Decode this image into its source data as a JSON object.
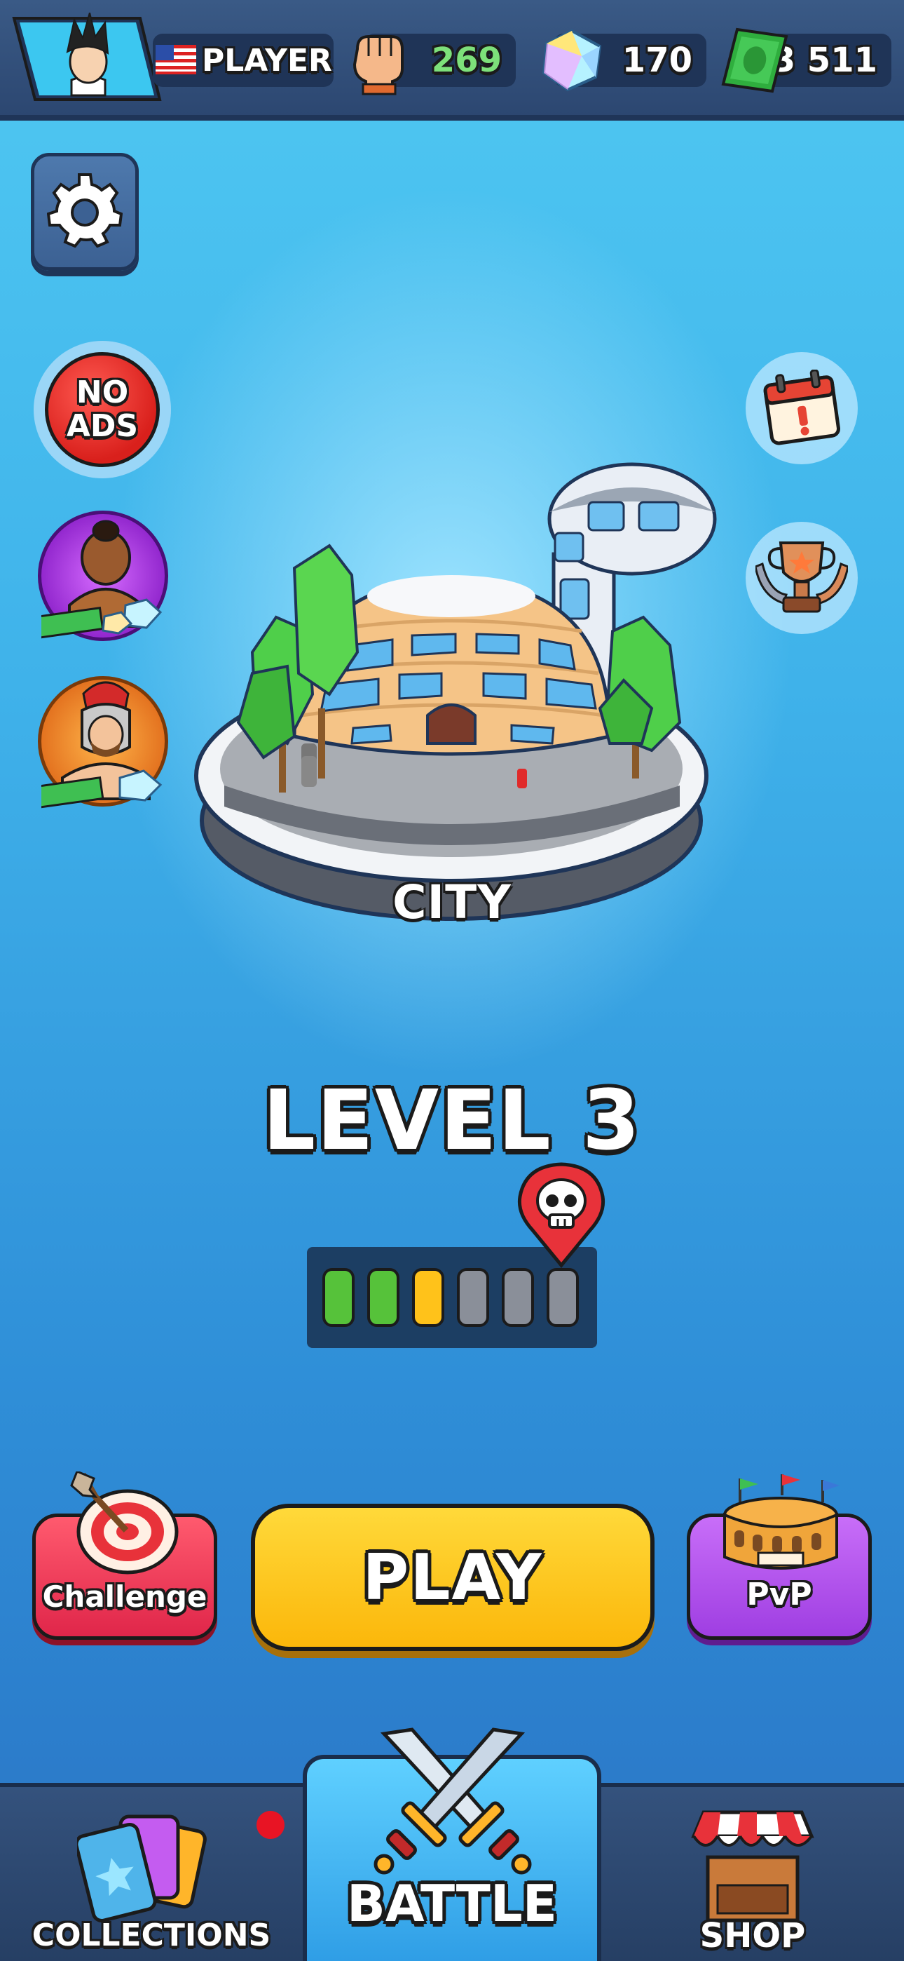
{
  "header": {
    "player_name": "PLAYER",
    "country_flag": "us-flag-icon",
    "power": "269",
    "gems": "170",
    "cash": "3 511",
    "power_color": "#7de07a"
  },
  "side_buttons": {
    "no_ads_line1": "NO",
    "no_ads_line2": "ADS"
  },
  "stage": {
    "location_name": "CITY",
    "level_title": "LEVEL 3",
    "progress": {
      "total": 6,
      "completed": 2,
      "current": 3,
      "boss_at": 6
    }
  },
  "actions": {
    "challenge_label": "Challenge",
    "play_label": "PLAY",
    "pvp_label": "PvP"
  },
  "nav": {
    "collections_label": "COLLECTIONS",
    "battle_label": "BATTLE",
    "shop_label": "SHOP"
  },
  "colors": {
    "segment_done": "#56c23a",
    "segment_current": "#ffc21a",
    "segment_todo": "#8a8f99",
    "play_button": "#fbb70a",
    "challenge_button": "#e0264a",
    "pvp_button": "#9f3ee2"
  }
}
